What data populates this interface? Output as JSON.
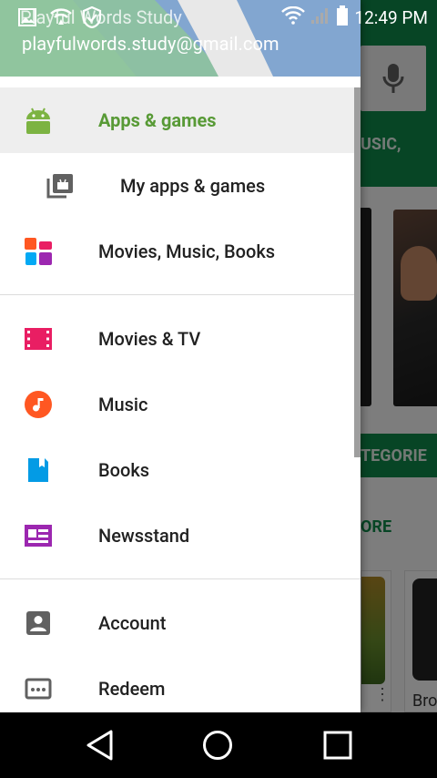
{
  "status_bar": {
    "app_title": "Playful Words Study",
    "time": "12:49 PM"
  },
  "account": {
    "email": "playfulwords.study@gmail.com"
  },
  "background": {
    "music_text": "USIC,",
    "categories_text": "TEGORIE",
    "more_text": "ORE",
    "tile_label": "Bro"
  },
  "drawer": {
    "items": [
      {
        "label": "Apps & games",
        "icon": "android-icon",
        "active": true
      },
      {
        "label": "My apps & games",
        "icon": "my-apps-icon"
      },
      {
        "label": "Movies, Music, Books",
        "icon": "entertainment-icon"
      },
      {
        "label": "Movies & TV",
        "icon": "movies-icon"
      },
      {
        "label": "Music",
        "icon": "music-icon"
      },
      {
        "label": "Books",
        "icon": "books-icon"
      },
      {
        "label": "Newsstand",
        "icon": "newsstand-icon"
      },
      {
        "label": "Account",
        "icon": "account-icon"
      },
      {
        "label": "Redeem",
        "icon": "redeem-icon"
      }
    ]
  },
  "colors": {
    "accent_green": "#589a36",
    "movies_red": "#e91e63",
    "music_orange": "#ff5722",
    "books_blue": "#039be5",
    "newsstand_purple": "#9c27b0"
  }
}
